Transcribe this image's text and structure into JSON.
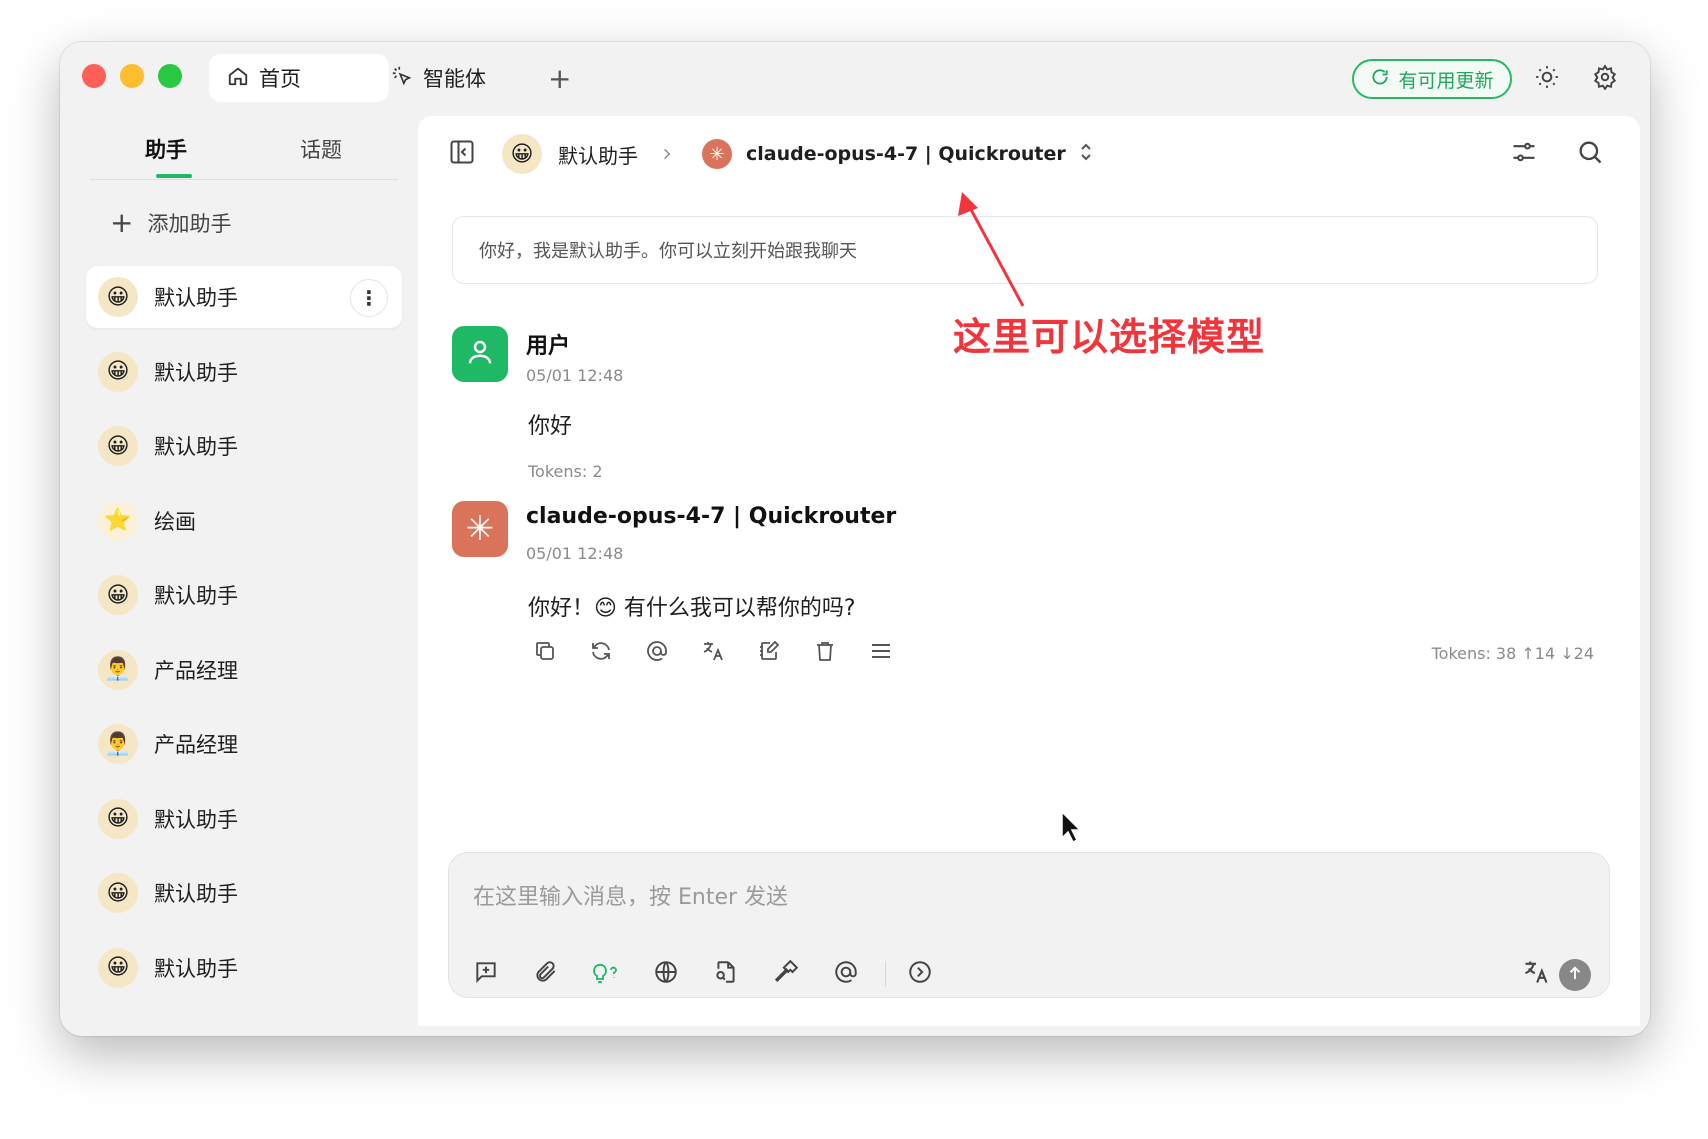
{
  "tabs": {
    "home_label": "首页",
    "agents_label": "智能体",
    "add_label": "+"
  },
  "titlebar": {
    "update_label": "有可用更新"
  },
  "sidebar": {
    "tab_assistants": "助手",
    "tab_topics": "话题",
    "add_assistant": "添加助手",
    "items": [
      {
        "label": "默认助手",
        "avatar": "😀"
      },
      {
        "label": "默认助手",
        "avatar": "😀"
      },
      {
        "label": "默认助手",
        "avatar": "😀"
      },
      {
        "label": "绘画",
        "avatar": "⭐"
      },
      {
        "label": "默认助手",
        "avatar": "😀"
      },
      {
        "label": "产品经理",
        "avatar": "👨‍💼"
      },
      {
        "label": "产品经理",
        "avatar": "👨‍💼"
      },
      {
        "label": "默认助手",
        "avatar": "😀"
      },
      {
        "label": "默认助手",
        "avatar": "😀"
      },
      {
        "label": "默认助手",
        "avatar": "😀"
      }
    ]
  },
  "header": {
    "assistant_name": "默认助手",
    "model_name": "claude-opus-4-7 | Quickrouter"
  },
  "chat": {
    "welcome": "你好，我是默认助手。你可以立刻开始跟我聊天",
    "messages": [
      {
        "name": "用户",
        "time": "05/01 12:48",
        "text": "你好",
        "tokens": "Tokens: 2"
      },
      {
        "name": "claude-opus-4-7 | Quickrouter",
        "time": "05/01 12:48",
        "text": "你好！😊 有什么我可以帮你的吗?",
        "tokens": "Tokens: 38 ↑14 ↓24"
      }
    ]
  },
  "annotation": "这里可以选择模型",
  "input": {
    "placeholder": "在这里输入消息，按 Enter 发送"
  },
  "colors": {
    "accent": "#1fb864",
    "annotation": "#f0353c",
    "model_brand": "#d9745a"
  }
}
